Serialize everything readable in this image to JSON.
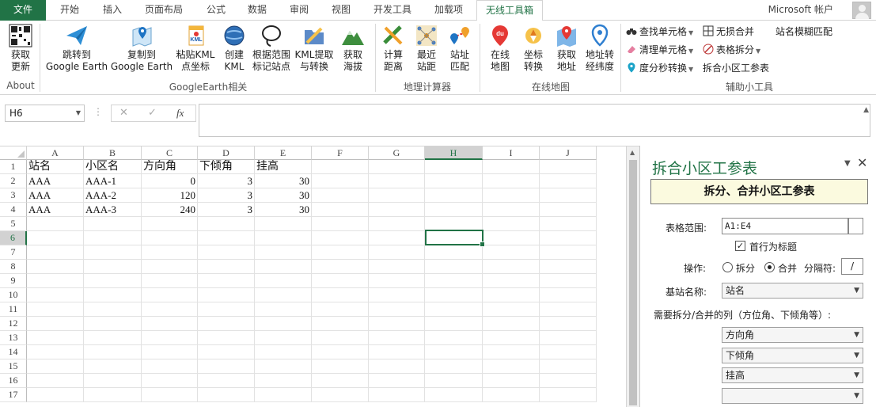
{
  "tabs": {
    "file": "文件",
    "items": [
      "开始",
      "插入",
      "页面布局",
      "公式",
      "数据",
      "审阅",
      "视图",
      "开发工具",
      "加载项",
      "无线工具箱"
    ],
    "active": "无线工具箱",
    "account": "Microsoft 帐户"
  },
  "ribbon": {
    "about": {
      "btn1": "获取",
      "btn2": "更新",
      "group": "About"
    },
    "google": {
      "goto1": "跳转到",
      "goto2": "Google Earth",
      "copy1": "复制到",
      "copy2": "Google Earth",
      "paste1": "粘贴KML",
      "paste2": "点坐标",
      "create1": "创建",
      "create2": "KML",
      "mark1": "根据范围",
      "mark2": "标记站点",
      "kml1": "KML提取",
      "kml2": "与转换",
      "alt1": "获取",
      "alt2": "海拔",
      "group": "GoogleEarth相关"
    },
    "geo": {
      "calc1": "计算",
      "calc2": "距离",
      "near1": "最近",
      "near2": "站距",
      "match1": "站址",
      "match2": "匹配",
      "group": "地理计算器"
    },
    "online": {
      "map1": "在线",
      "map2": "地图",
      "coord1": "坐标",
      "coord2": "转换",
      "addr1": "获取",
      "addr2": "地址",
      "addrconv1": "地址转",
      "addrconv2": "经纬度",
      "group": "在线地图"
    },
    "tools": {
      "find": "查找单元格",
      "clear": "清理单元格",
      "dms": "度分秒转换",
      "unmerge": "无损合并",
      "split": "表格拆分",
      "params": "拆合小区工参表",
      "fuzzy": "站名模糊匹配",
      "group": "辅助小工具"
    }
  },
  "formula_bar": {
    "name_box": "H6",
    "cancel": "✕",
    "enter": "✓",
    "fx": "fx",
    "value": ""
  },
  "grid": {
    "columns": [
      "A",
      "B",
      "C",
      "D",
      "E",
      "F",
      "G",
      "H",
      "I",
      "J"
    ],
    "rows": [
      "1",
      "2",
      "3",
      "4",
      "5",
      "6",
      "7",
      "8",
      "9",
      "10",
      "11",
      "12",
      "13",
      "14",
      "15",
      "16",
      "17"
    ],
    "selected_cell": "H6",
    "header_row": [
      "站名",
      "小区名",
      "方向角",
      "下倾角",
      "挂高"
    ],
    "data": [
      [
        "AAA",
        "AAA-1",
        "0",
        "3",
        "30"
      ],
      [
        "AAA",
        "AAA-2",
        "120",
        "3",
        "30"
      ],
      [
        "AAA",
        "AAA-3",
        "240",
        "3",
        "30"
      ]
    ]
  },
  "pane": {
    "title": "拆合小区工参表",
    "banner": "拆分、合并小区工参表",
    "range_label": "表格范围:",
    "range_value": "A1:E4",
    "first_row_header": "首行为标题",
    "first_row_checked": true,
    "op_label": "操作:",
    "op_split": "拆分",
    "op_merge": "合并",
    "op_selected": "合并",
    "sep_label": "分隔符:",
    "sep_value": "/",
    "base_label": "基站名称:",
    "base_value": "站名",
    "cols_label": "需要拆分/合并的列（方位角、下倾角等）:",
    "col_selects": [
      "方向角",
      "下倾角",
      "挂高",
      ""
    ]
  }
}
